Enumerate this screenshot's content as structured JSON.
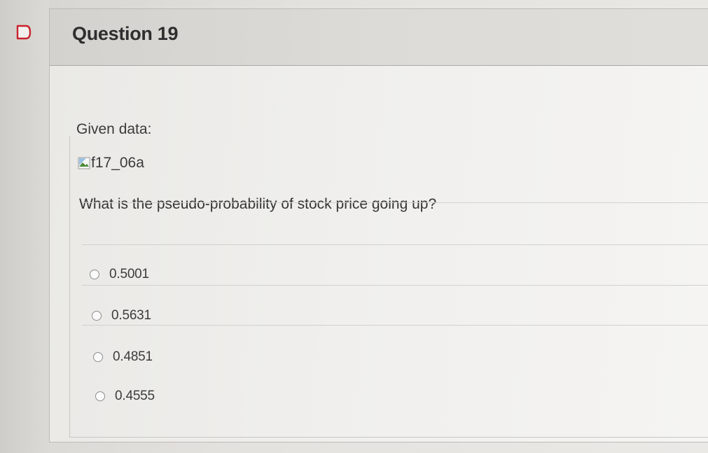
{
  "question": {
    "title": "Question 19",
    "given_text": "Given data:",
    "image_alt": "f17_06a",
    "prompt": "What is the pseudo-probability of stock price going up?"
  },
  "answers": [
    {
      "label": "0.5001",
      "selected": false
    },
    {
      "label": "0.5631",
      "selected": false
    },
    {
      "label": "0.4851",
      "selected": false
    },
    {
      "label": "0.4555",
      "selected": false
    }
  ],
  "icons": {
    "flag": "flag-icon",
    "broken_image": "broken-image-icon",
    "radio": "radio-button"
  },
  "colors": {
    "header_bg": "#d9d7d3",
    "body_bg": "#f0efed",
    "text": "#333333",
    "flag_border": "#c8232c"
  }
}
